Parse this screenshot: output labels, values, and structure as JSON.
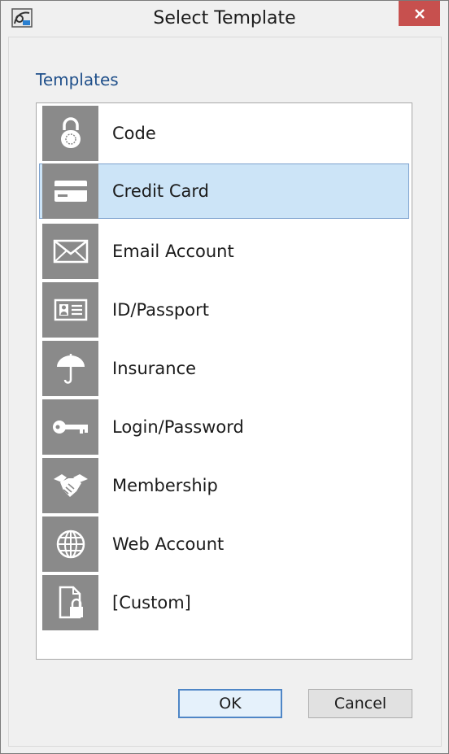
{
  "window": {
    "title": "Select Template"
  },
  "templates": {
    "label": "Templates",
    "items": [
      {
        "label": "Code",
        "icon": "padlock-icon"
      },
      {
        "label": "Credit Card",
        "icon": "credit-card-icon",
        "selected": true
      },
      {
        "label": "Email Account",
        "icon": "envelope-icon"
      },
      {
        "label": "ID/Passport",
        "icon": "id-card-icon"
      },
      {
        "label": "Insurance",
        "icon": "umbrella-icon"
      },
      {
        "label": "Login/Password",
        "icon": "key-icon"
      },
      {
        "label": "Membership",
        "icon": "handshake-icon"
      },
      {
        "label": "Web Account",
        "icon": "globe-icon"
      },
      {
        "label": "[Custom]",
        "icon": "document-lock-icon"
      }
    ]
  },
  "buttons": {
    "ok": "OK",
    "cancel": "Cancel"
  },
  "colors": {
    "tile": "#8a8a8a",
    "selection": "#cce4f7",
    "close": "#c7504e",
    "section_label": "#1f4f8a"
  }
}
